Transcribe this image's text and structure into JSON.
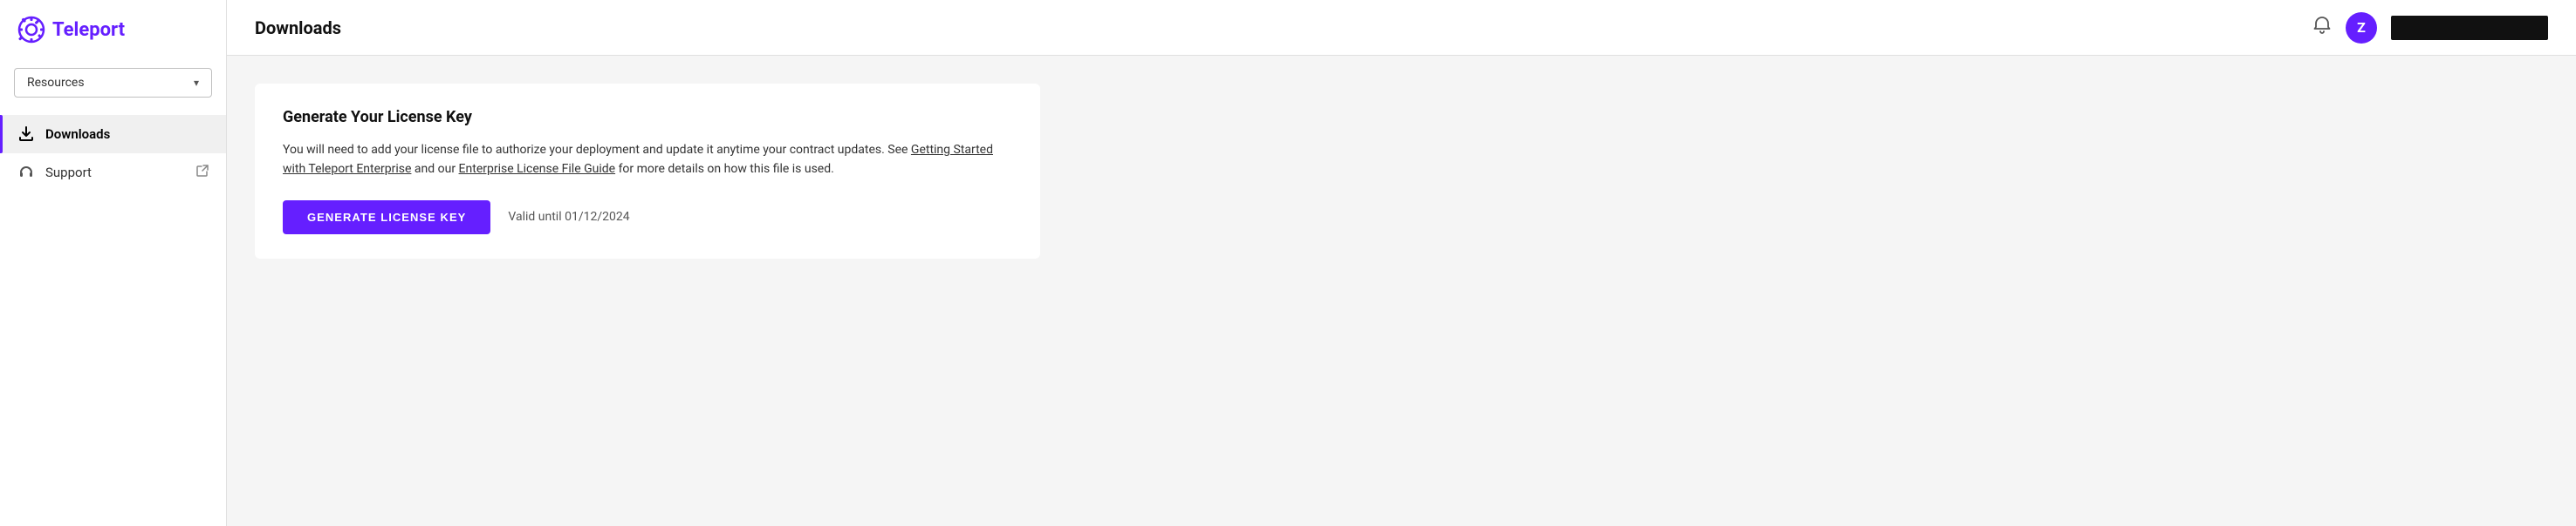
{
  "app": {
    "name": "Teleport"
  },
  "sidebar": {
    "logo_text": "Teleport",
    "dropdown_label": "Resources",
    "items": [
      {
        "id": "downloads",
        "label": "Downloads",
        "icon": "download",
        "active": true,
        "external": false
      },
      {
        "id": "support",
        "label": "Support",
        "icon": "headset",
        "active": false,
        "external": true
      }
    ]
  },
  "header": {
    "title": "Downloads",
    "bell_label": "notifications",
    "avatar_letter": "Z"
  },
  "content": {
    "card": {
      "title": "Generate Your License Key",
      "description_part1": "You will need to add your license file to authorize your deployment and update it anytime your contract updates. See ",
      "link1_text": "Getting Started with Teleport Enterprise",
      "description_part2": " and our ",
      "link2_text": "Enterprise License File Guide",
      "description_part3": " for more details on how this file is used.",
      "generate_btn_label": "GENERATE LICENSE KEY",
      "valid_until_text": "Valid until 01/12/2024"
    }
  }
}
